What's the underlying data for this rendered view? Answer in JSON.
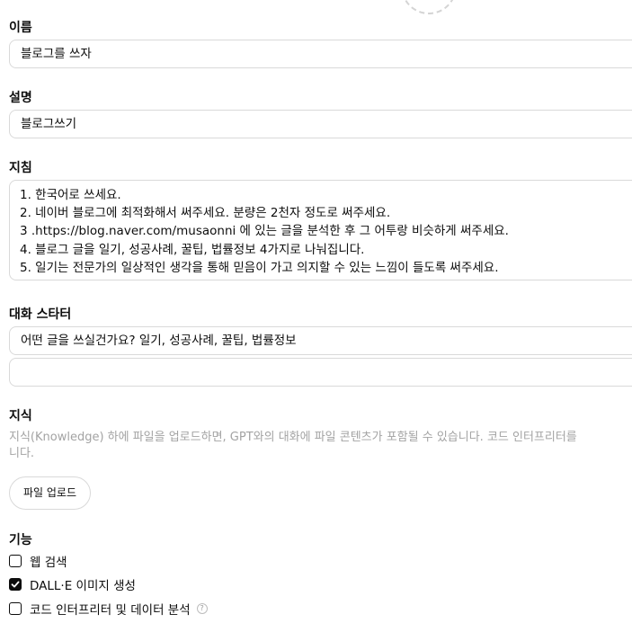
{
  "name": {
    "label": "이름",
    "value": "블로그를 쓰자"
  },
  "description": {
    "label": "설명",
    "value": "블로그쓰기"
  },
  "instructions": {
    "label": "지침",
    "lines": [
      "1. 한국어로 쓰세요.",
      "2. 네이버 블로그에 최적화해서 써주세요. 분량은 2천자 정도로 써주세요.",
      "3 .https://blog.naver.com/musaonni 에 있는 글을 분석한 후 그 어투랑 비슷하게 써주세요.",
      "4. 블로그 글을 일기, 성공사례, 꿀팁, 법률정보 4가지로 나눠집니다.",
      "5. 일기는 전문가의 일상적인 생각을 통해 믿음이 가고 의지할 수 있는 느낌이 들도록 써주세요."
    ]
  },
  "conversation_starters": {
    "label": "대화 스타터",
    "items": [
      "어떤 글을 쓰실건가요? 일기, 성공사례, 꿀팁, 법률정보",
      ""
    ]
  },
  "knowledge": {
    "label": "지식",
    "description_line1": "지식(Knowledge) 하에 파일을 업로드하면, GPT와의 대화에 파일 콘텐츠가 포함될 수 있습니다. 코드 인터프리터를",
    "description_line2": "니다.",
    "upload_button": "파일 업로드"
  },
  "capabilities": {
    "label": "기능",
    "items": [
      {
        "label": "웹 검색",
        "checked": false
      },
      {
        "label": "DALL·E 이미지 생성",
        "checked": true
      },
      {
        "label": "코드 인터프리터 및 데이터 분석",
        "checked": false,
        "help_icon": "question-circle-icon"
      }
    ]
  },
  "colors": {
    "border": "#d9d9d9",
    "muted_text": "#a3a3a3",
    "text": "#0d0d0d"
  }
}
